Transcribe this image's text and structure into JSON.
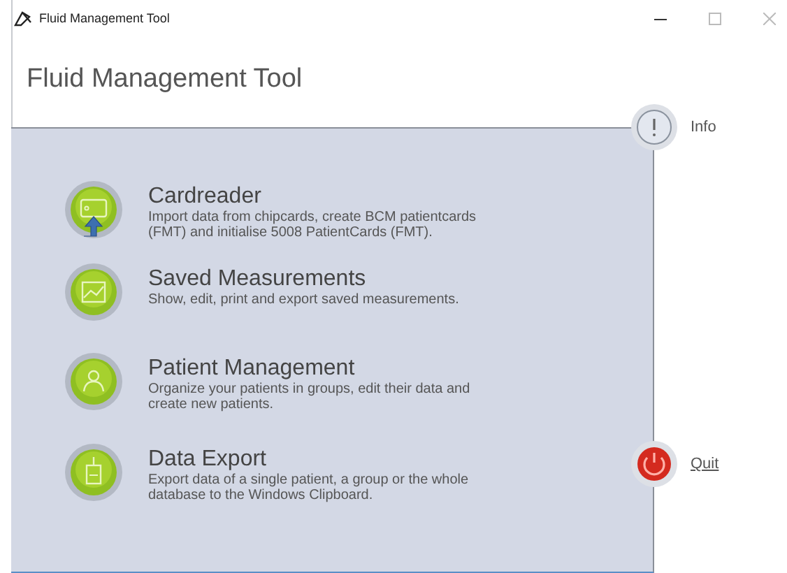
{
  "window": {
    "title": "Fluid Management Tool"
  },
  "header": {
    "title": "Fluid Management Tool"
  },
  "menu_items": [
    {
      "kind": "cardreader",
      "title": "Cardreader",
      "description": "Import data from chipcards, create BCM patientcards (FMT) and initialise 5008 PatientCards (FMT)."
    },
    {
      "kind": "measurements",
      "title": "Saved Measurements",
      "description": "Show, edit, print and export saved measurements."
    },
    {
      "kind": "patients",
      "title": "Patient Management",
      "description": "Organize your patients in groups, edit their data and create new patients."
    },
    {
      "kind": "export",
      "title": "Data Export",
      "description": "Export data of a single patient, a group or the whole database to the Windows Clipboard."
    }
  ],
  "side_buttons": [
    {
      "kind": "info",
      "label": "Info"
    },
    {
      "kind": "quit",
      "label": "Quit"
    }
  ]
}
